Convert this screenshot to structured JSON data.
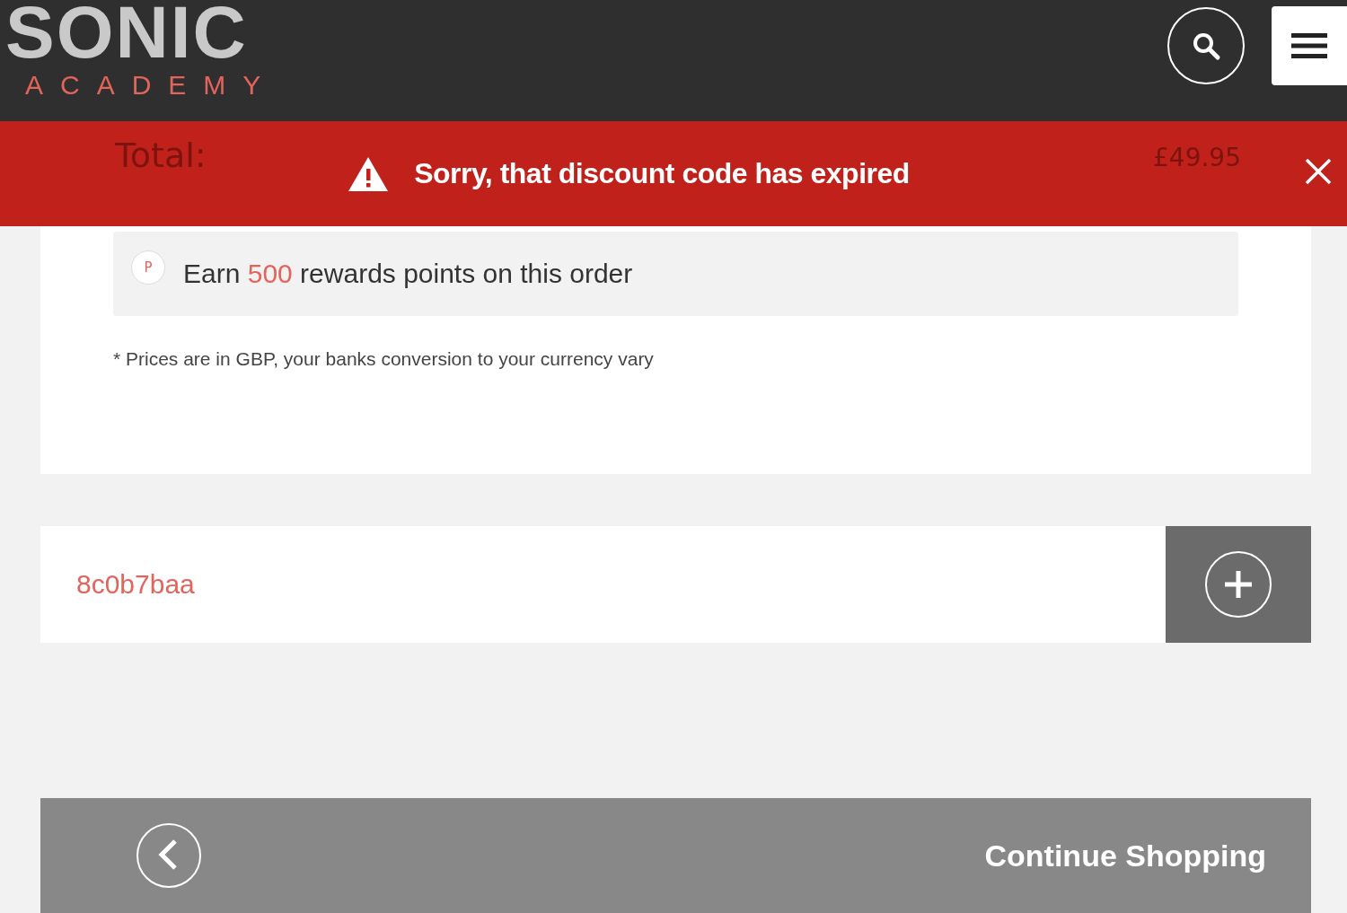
{
  "header": {
    "logo": {
      "title": "SONIC",
      "subtitle": "ACADEMY"
    }
  },
  "alert": {
    "message": "Sorry, that discount code has expired",
    "behind": {
      "label": "Total:",
      "value": "£49.95"
    }
  },
  "rewards": {
    "badge": "P",
    "before": "Earn",
    "points": "500",
    "after": "rewards points on this order"
  },
  "note": "* Prices are in GBP, your banks conversion to your currency vary",
  "discount_field": {
    "value": "8c0b7baa"
  },
  "continue_button": {
    "label": "Continue Shopping"
  }
}
